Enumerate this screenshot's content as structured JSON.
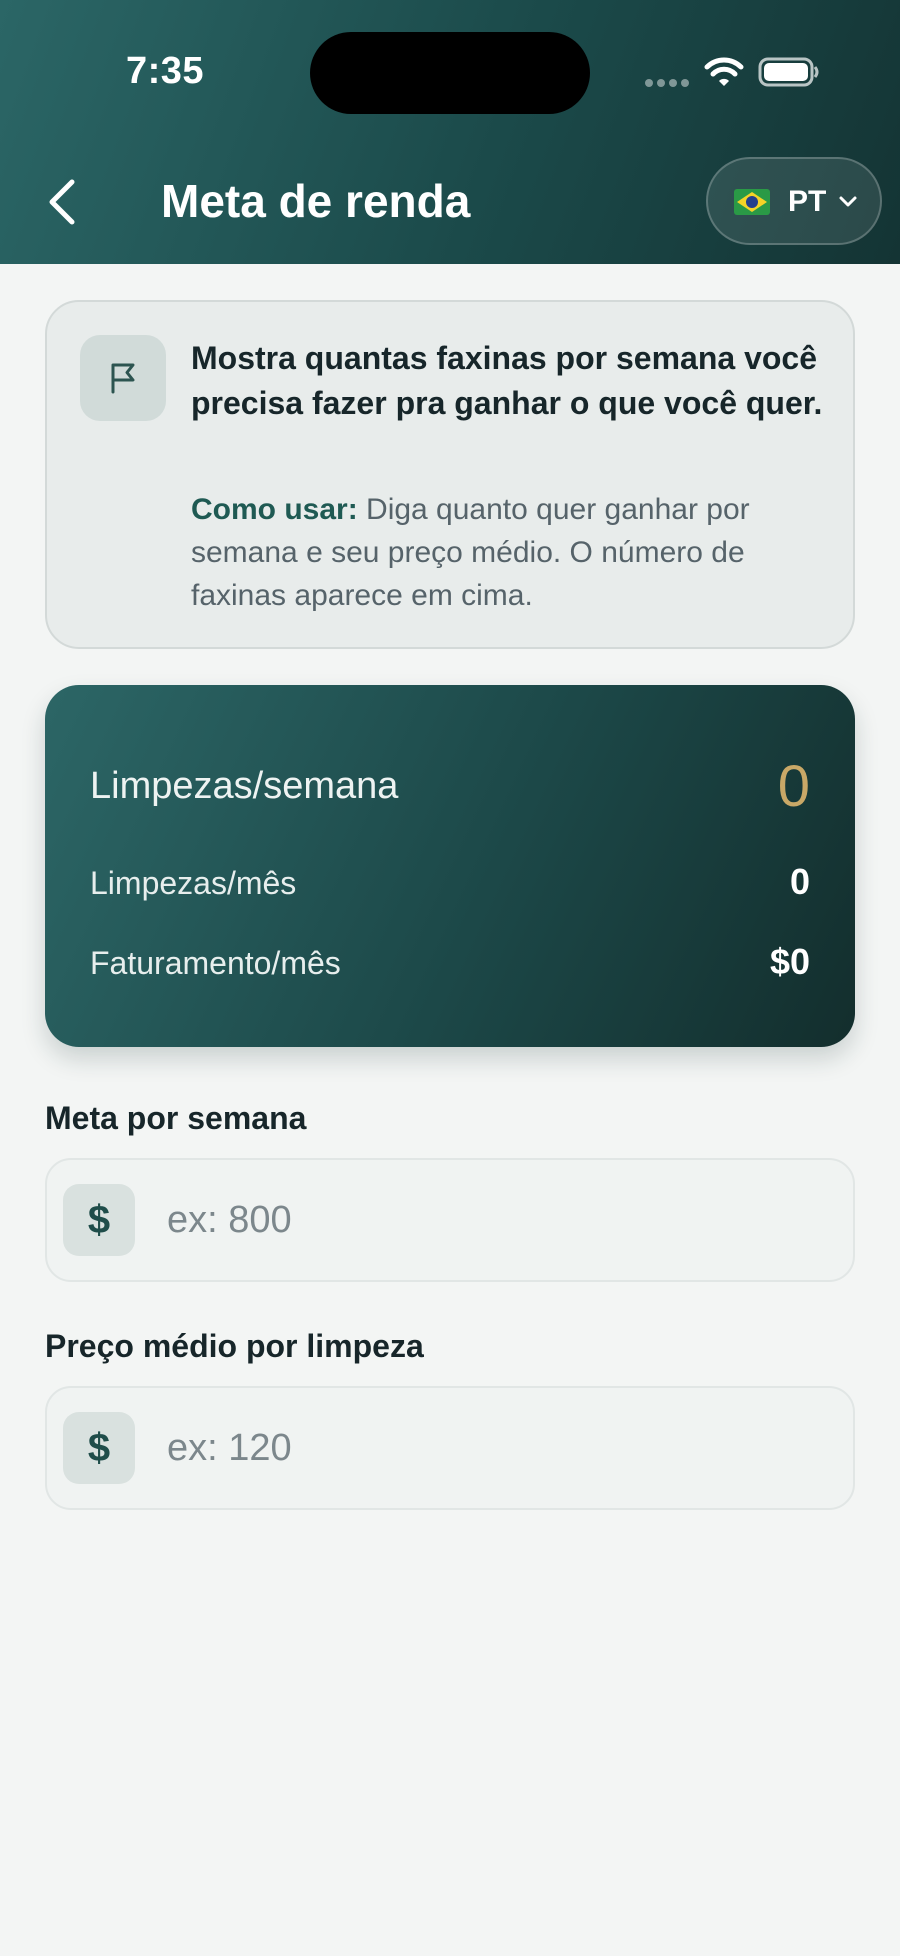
{
  "status_bar": {
    "time": "7:35"
  },
  "header": {
    "title": "Meta de renda",
    "language": "PT",
    "flag": "brazil-flag-icon"
  },
  "info": {
    "title": "Mostra quantas faxinas por semana você precisa fazer pra ganhar o que você quer.",
    "how_label": "Como usar:",
    "how_text": " Diga quanto quer ganhar por semana e seu preço médio. O número de faxinas aparece em cima."
  },
  "results": {
    "per_week_label": "Limpezas/semana",
    "per_week_value": "0",
    "per_month_label": "Limpezas/mês",
    "per_month_value": "0",
    "revenue_label": "Faturamento/mês",
    "revenue_value": "$0"
  },
  "form": {
    "goal_label": "Meta por semana",
    "goal_currency": "$",
    "goal_placeholder": "ex: 800",
    "goal_value": "",
    "price_label": "Preço médio por limpeza",
    "price_currency": "$",
    "price_placeholder": "ex: 120",
    "price_value": ""
  },
  "colors": {
    "header_dark": "#1b4a4a",
    "accent_gold": "#c9a867",
    "background": "#f3f5f4"
  }
}
